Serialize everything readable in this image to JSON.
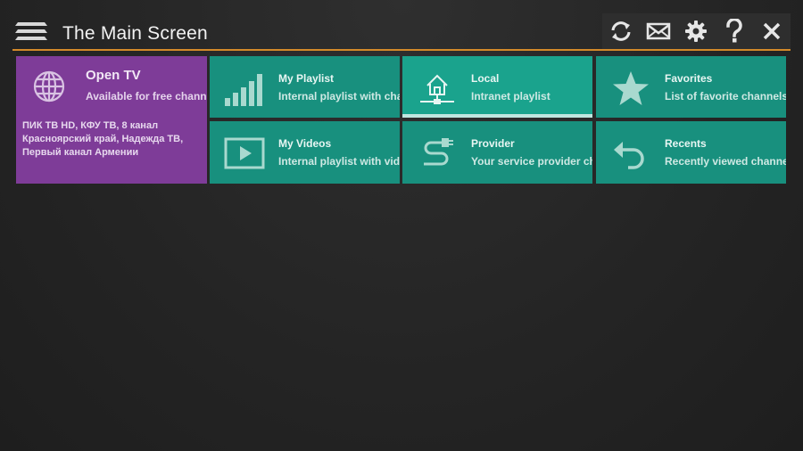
{
  "header": {
    "title": "The Main Screen",
    "accent_color": "#d48a2a",
    "toolbar": {
      "icons": [
        "refresh-icon",
        "mail-icon",
        "gear-icon",
        "help-icon",
        "close-icon"
      ]
    }
  },
  "open_tv": {
    "title": "Open TV",
    "subtitle": "Available for free channels",
    "channels": "ПИК ТВ HD, КФУ ТВ, 8 канал Красноярский край, Надежда ТВ, Первый канал Армении",
    "color": "#7e3c98"
  },
  "tiles": [
    {
      "title": "My Playlist",
      "subtitle": "Internal playlist with chann",
      "icon": "signal-bars-icon"
    },
    {
      "title": "Local",
      "subtitle": "Intranet playlist",
      "icon": "network-icon",
      "selected": true
    },
    {
      "title": "Favorites",
      "subtitle": "List of favorite channels",
      "icon": "star-icon"
    },
    {
      "title": "My Videos",
      "subtitle": "Internal playlist with video",
      "icon": "play-icon"
    },
    {
      "title": "Provider",
      "subtitle": "Your service provider chan",
      "icon": "cable-icon"
    },
    {
      "title": "Recents",
      "subtitle": "Recently viewed channels",
      "icon": "undo-icon"
    }
  ],
  "tile_color": "#18907e"
}
